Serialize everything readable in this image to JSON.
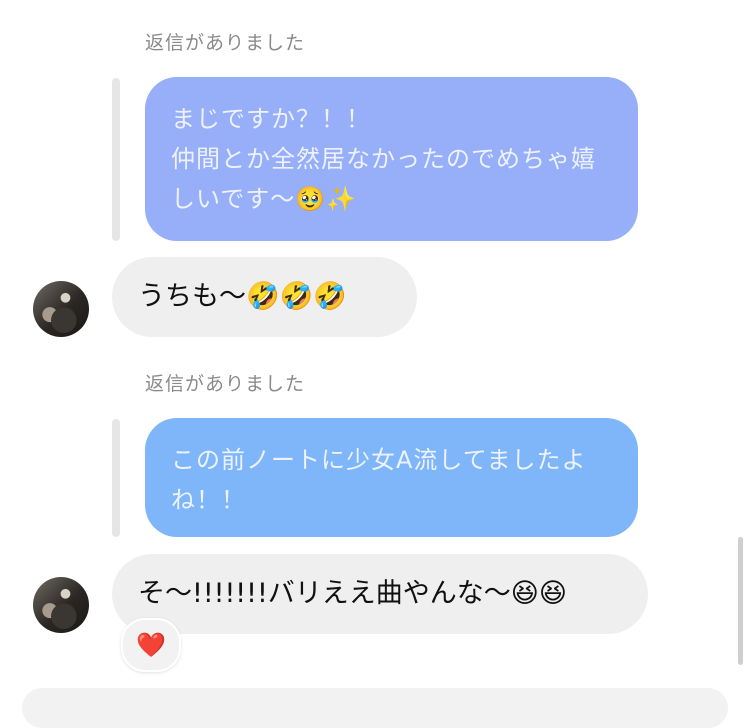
{
  "messages": [
    {
      "reply_label": "返信がありました",
      "quoted_lines": [
        "まじですか？！！",
        "仲間とか全然居なかったのでめちゃ嬉",
        "しいです〜🥹✨"
      ],
      "quoted_color": "#97aef8",
      "reply_text": "うちも〜🤣🤣🤣"
    },
    {
      "reply_label": "返信がありました",
      "quoted_lines": [
        "この前ノートに少女A流してましたよ",
        "ね！！"
      ],
      "quoted_color": "#7eb6f9",
      "reply_text": "そ〜!!!!!!!バリええ曲やんな〜😆😆"
    }
  ],
  "reaction": {
    "emoji": "❤️"
  }
}
